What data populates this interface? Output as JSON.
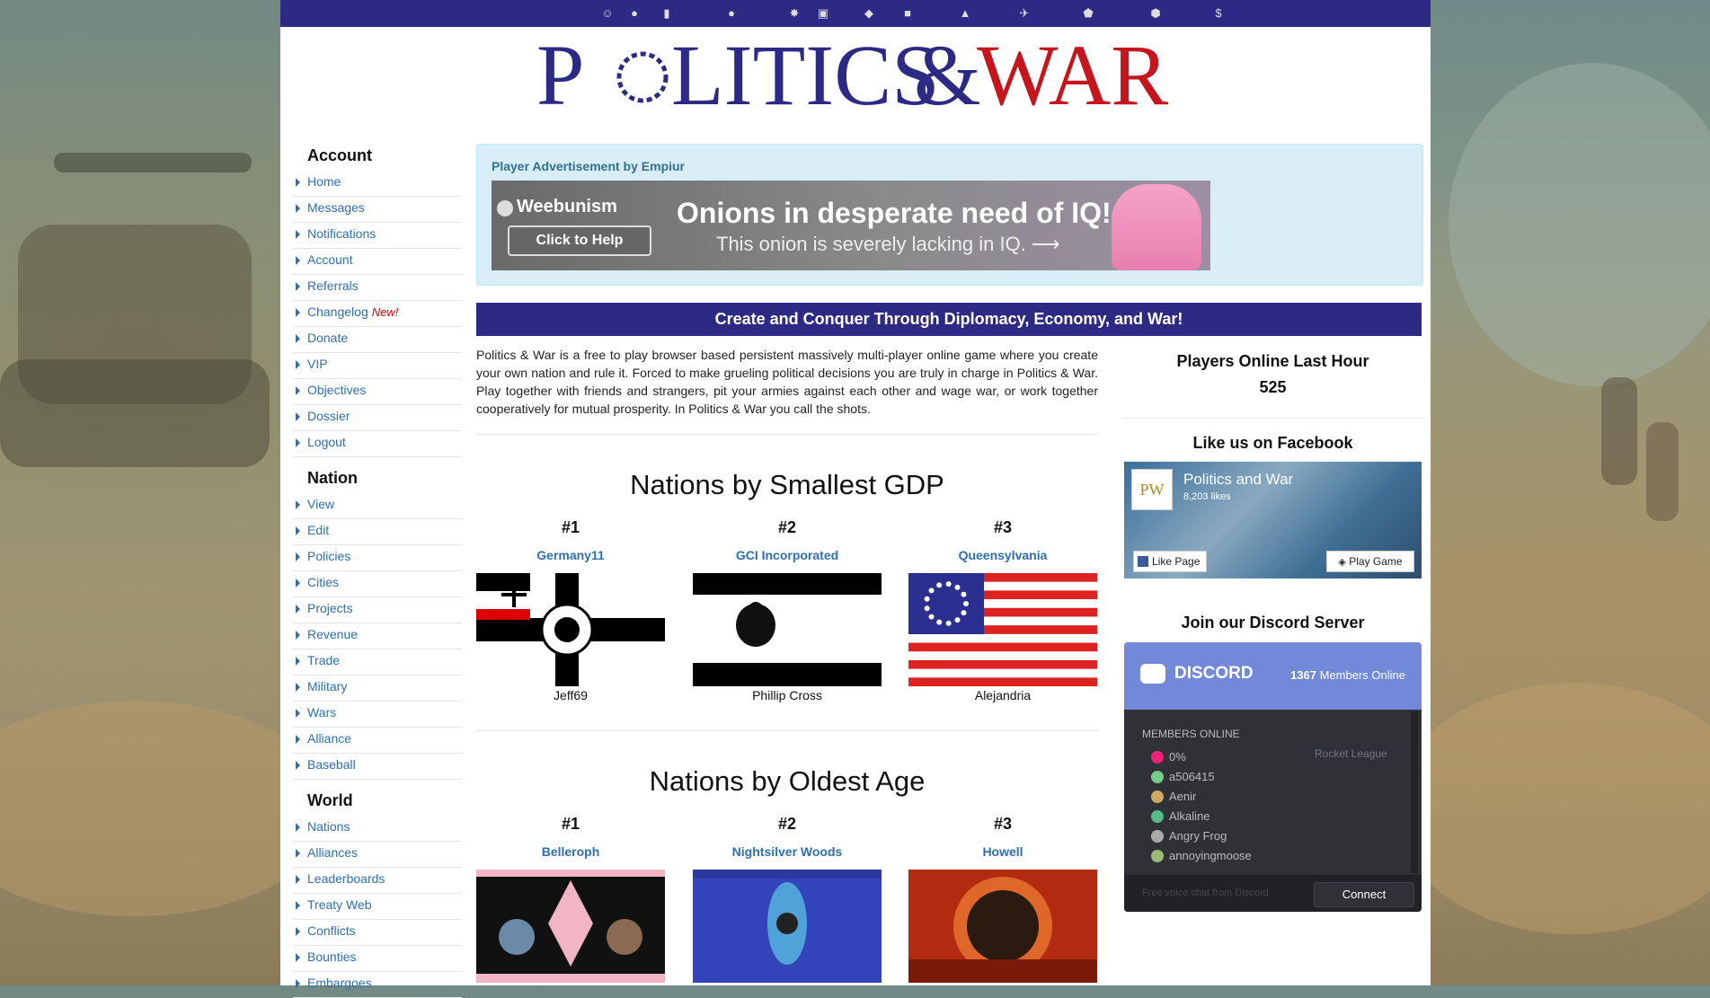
{
  "colors": {
    "nav_bar": "#2d2a86",
    "link": "#2d6fb0",
    "ad_bg": "#d9edf7",
    "discord": "#7289da"
  },
  "topbar_icons": [
    "smiley-icon",
    "tank-icon",
    "barrel-icon",
    "coin-icon",
    "bomb-icon",
    "ammo-icon",
    "pill-icon",
    "box-icon",
    "chart-icon",
    "plane-icon",
    "shield-icon",
    "badge-icon",
    "dollar-icon"
  ],
  "logo": {
    "text": "POLITICS & WAR"
  },
  "sidebar": {
    "account_title": "Account",
    "account_items": [
      "Home",
      "Messages",
      "Notifications",
      "Account",
      "Referrals",
      "Changelog",
      "Donate",
      "VIP",
      "Objectives",
      "Dossier",
      "Logout"
    ],
    "new_badge": "New!",
    "nation_title": "Nation",
    "nation_items": [
      "View",
      "Edit",
      "Policies",
      "Cities",
      "Projects",
      "Revenue",
      "Trade",
      "Military",
      "Wars",
      "Alliance",
      "Baseball"
    ],
    "world_title": "World",
    "world_items": [
      "Nations",
      "Alliances",
      "Leaderboards",
      "Treaty Web",
      "Conflicts",
      "Bounties",
      "Embargoes"
    ]
  },
  "ad": {
    "title": "Player Advertisement by Empiur",
    "brand": "Weebunism",
    "button": "Click to Help",
    "headline": "Onions in desperate need of IQ!",
    "subline": "This onion is severely lacking in IQ. ⟶"
  },
  "banner": "Create and Conquer Through Diplomacy, Economy, and War!",
  "intro": "Politics & War is a free to play browser based persistent massively multi-player online game where you create your own nation and rule it. Forced to make grueling political decisions you are truly in charge in Politics & War. Play together with friends and strangers, pit your armies against each other and wage war, or work together cooperatively for mutual prosperity. In Politics & War you call the shots.",
  "gdp": {
    "title": "Nations by Smallest GDP",
    "nations": [
      {
        "rank": "#1",
        "name": "Germany11",
        "leader": "Jeff69"
      },
      {
        "rank": "#2",
        "name": "GCI Incorporated",
        "leader": "Phillip Cross"
      },
      {
        "rank": "#3",
        "name": "Queensylvania",
        "leader": "Alejandria"
      }
    ]
  },
  "age": {
    "title": "Nations by Oldest Age",
    "nations": [
      {
        "rank": "#1",
        "name": "Belleroph"
      },
      {
        "rank": "#2",
        "name": "Nightsilver Woods"
      },
      {
        "rank": "#3",
        "name": "Howell"
      }
    ]
  },
  "online": {
    "title": "Players Online Last Hour",
    "count": "525"
  },
  "facebook": {
    "title": "Like us on Facebook",
    "page_name": "Politics and War",
    "likes": "8,203 likes",
    "like_button": "Like Page",
    "play_button": "Play Game",
    "logo": "PW"
  },
  "discord": {
    "title": "Join our Discord Server",
    "brand": "DISCORD",
    "members_count": "1367",
    "members_label": "Members Online",
    "section_label": "MEMBERS ONLINE",
    "members": [
      "0%",
      "a506415",
      "Aenir",
      "Alkaline",
      "Angry Frog",
      "annoyingmoose"
    ],
    "game": "Rocket League",
    "footer_text": "Free voice chat from Discord",
    "connect": "Connect"
  }
}
